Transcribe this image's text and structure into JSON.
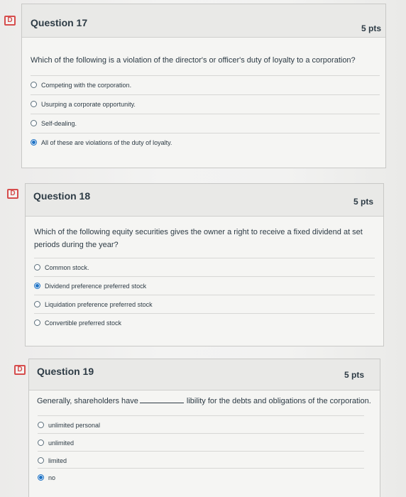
{
  "flag_glyph": "D",
  "colors": {
    "flag": "#d64d4d",
    "selected_radio": "#1f73c4",
    "text": "#2d3b45"
  },
  "questions": [
    {
      "title": "Question 17",
      "points": "5 pts",
      "text": "Which of the following is a violation of the director's or officer's duty of loyalty to a corporation?",
      "options": [
        {
          "label": "Competing with the corporation.",
          "selected": false
        },
        {
          "label": "Usurping a corporate opportunity.",
          "selected": false
        },
        {
          "label": "Self-dealing.",
          "selected": false
        },
        {
          "label": "All of these are violations of the duty of loyalty.",
          "selected": true
        }
      ]
    },
    {
      "title": "Question 18",
      "points": "5 pts",
      "text": "Which of the following equity securities gives the owner a right to receive a fixed dividend at set periods during the year?",
      "options": [
        {
          "label": "Common stock.",
          "selected": false
        },
        {
          "label": "Dividend preference preferred stock",
          "selected": true
        },
        {
          "label": "Liquidation preference preferred stock",
          "selected": false
        },
        {
          "label": "Convertible preferred stock",
          "selected": false
        }
      ]
    },
    {
      "title": "Question 19",
      "points": "5 pts",
      "text_before": "Generally, shareholders have",
      "text_after": "libility for the debts and obligations of the corporation.",
      "options": [
        {
          "label": "unlimited personal",
          "selected": false
        },
        {
          "label": "unlimited",
          "selected": false
        },
        {
          "label": "limited",
          "selected": false
        },
        {
          "label": "no",
          "selected": true
        }
      ]
    }
  ]
}
